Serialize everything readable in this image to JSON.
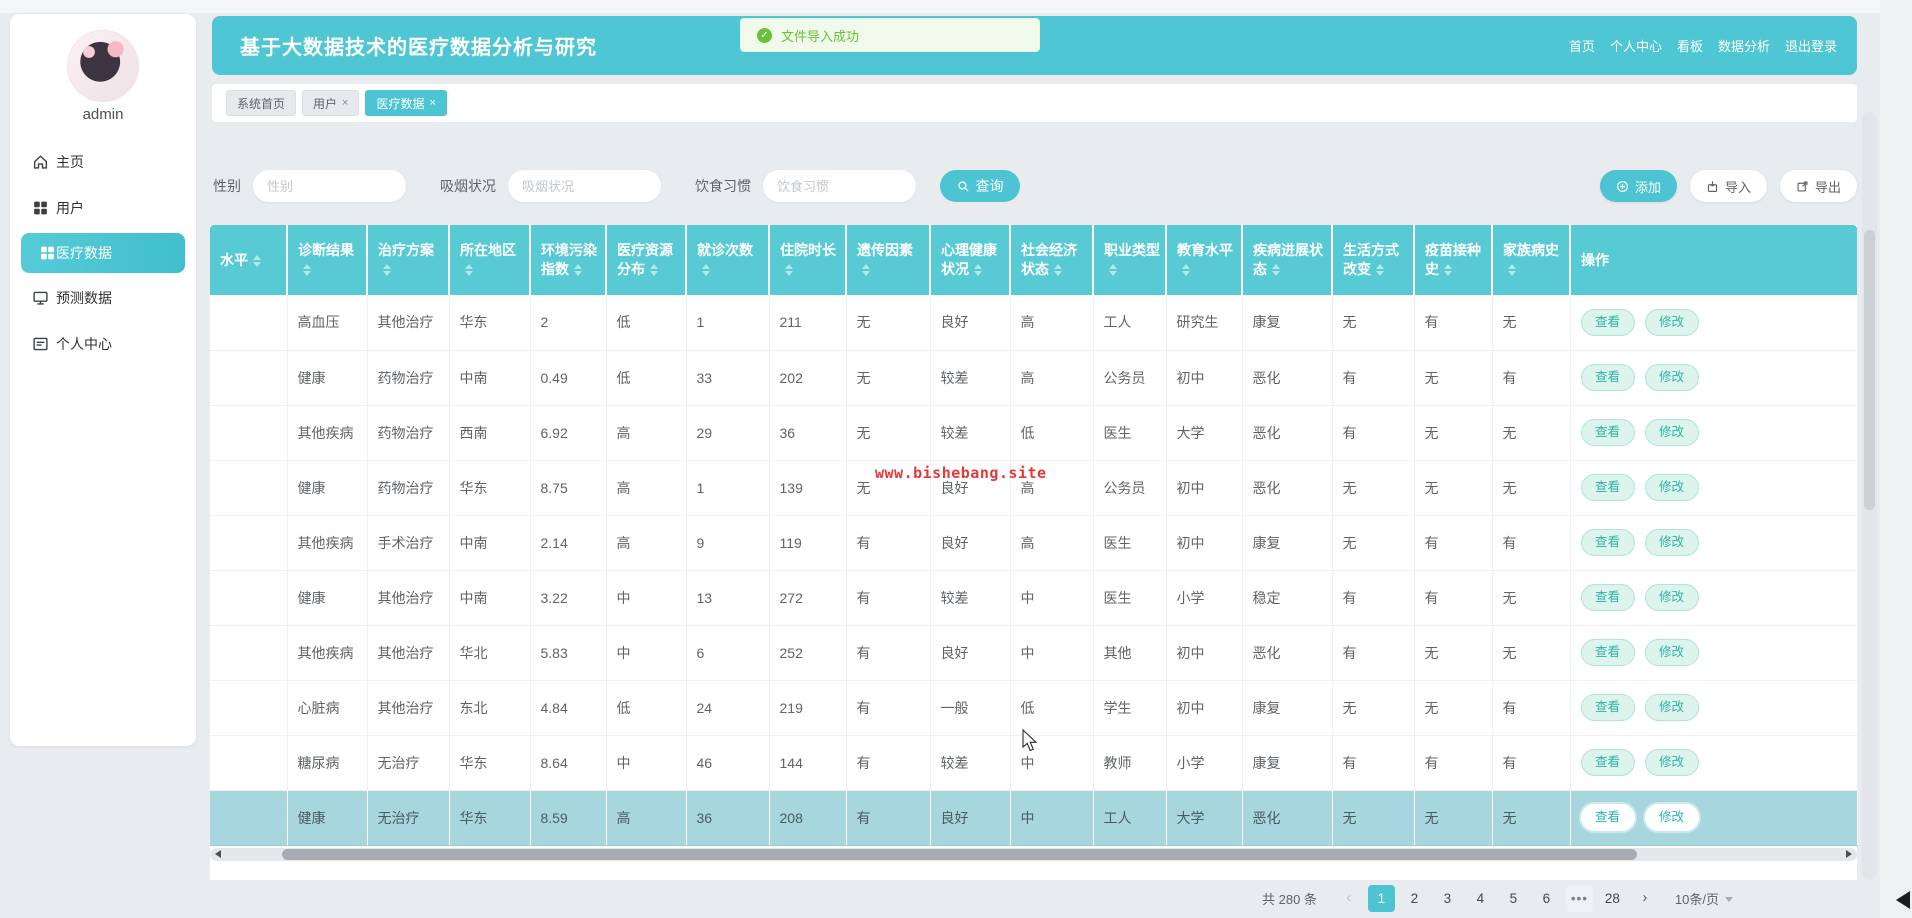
{
  "app": {
    "accent_color": "#4cc4d1",
    "header_teal": "#57cad3",
    "highlight_row_color": "#a7d6df",
    "toast_green": "#67c23a",
    "watermark_red": "#e03a3a"
  },
  "header": {
    "title": "基于大数据技术的医疗数据分析与研究",
    "nav": [
      "首页",
      "个人中心",
      "看板",
      "数据分析",
      "退出登录"
    ]
  },
  "toast": {
    "message": "文件导入成功",
    "icon": "check-circle-icon"
  },
  "sidebar": {
    "username": "admin",
    "items": [
      {
        "label": "主页",
        "icon": "home",
        "active": false
      },
      {
        "label": "用户",
        "icon": "grid",
        "active": false
      },
      {
        "label": "医疗数据",
        "icon": "grid",
        "active": true
      },
      {
        "label": "预测数据",
        "icon": "monitor",
        "active": false
      },
      {
        "label": "个人中心",
        "icon": "card",
        "active": false
      }
    ]
  },
  "tabs": [
    {
      "label": "系统首页",
      "closable": false,
      "active": false
    },
    {
      "label": "用户",
      "closable": true,
      "active": false
    },
    {
      "label": "医疗数据",
      "closable": true,
      "active": true
    }
  ],
  "filters": {
    "fields": [
      {
        "label": "性别",
        "placeholder": "性别",
        "value": ""
      },
      {
        "label": "吸烟状况",
        "placeholder": "吸烟状况",
        "value": ""
      },
      {
        "label": "饮食习惯",
        "placeholder": "饮食习惯",
        "value": ""
      }
    ],
    "search_label": "查询"
  },
  "toolbar": {
    "add_label": "添加",
    "import_label": "导入",
    "export_label": "导出"
  },
  "table": {
    "columns": [
      {
        "label": "水平",
        "sortable": true
      },
      {
        "label": "诊断结果",
        "sortable": true
      },
      {
        "label": "治疗方案",
        "sortable": true
      },
      {
        "label": "所在地区",
        "sortable": true
      },
      {
        "label": "环境污染指数",
        "sortable": true
      },
      {
        "label": "医疗资源分布",
        "sortable": true
      },
      {
        "label": "就诊次数",
        "sortable": true
      },
      {
        "label": "住院时长",
        "sortable": true
      },
      {
        "label": "遗传因素",
        "sortable": true
      },
      {
        "label": "心理健康状况",
        "sortable": true
      },
      {
        "label": "社会经济状态",
        "sortable": true
      },
      {
        "label": "职业类型",
        "sortable": true
      },
      {
        "label": "教育水平",
        "sortable": true
      },
      {
        "label": "疾病进展状态",
        "sortable": true
      },
      {
        "label": "生活方式改变",
        "sortable": true
      },
      {
        "label": "疫苗接种史",
        "sortable": true
      },
      {
        "label": "家族病史",
        "sortable": true
      },
      {
        "label": "操作",
        "sortable": false
      }
    ],
    "action_labels": [
      "查看",
      "修改"
    ],
    "highlighted_row_index": 9,
    "rows": [
      {
        "cells": [
          "高血压",
          "其他治疗",
          "华东",
          "2",
          "低",
          "1",
          "211",
          "无",
          "良好",
          "高",
          "工人",
          "研究生",
          "康复",
          "无",
          "有",
          "无"
        ]
      },
      {
        "cells": [
          "健康",
          "药物治疗",
          "中南",
          "0.49",
          "低",
          "33",
          "202",
          "无",
          "较差",
          "高",
          "公务员",
          "初中",
          "恶化",
          "有",
          "无",
          "有"
        ]
      },
      {
        "cells": [
          "其他疾病",
          "药物治疗",
          "西南",
          "6.92",
          "高",
          "29",
          "36",
          "无",
          "较差",
          "低",
          "医生",
          "大学",
          "恶化",
          "有",
          "无",
          "无"
        ]
      },
      {
        "cells": [
          "健康",
          "药物治疗",
          "华东",
          "8.75",
          "高",
          "1",
          "139",
          "无",
          "良好",
          "高",
          "公务员",
          "初中",
          "恶化",
          "无",
          "无",
          "无"
        ]
      },
      {
        "cells": [
          "其他疾病",
          "手术治疗",
          "中南",
          "2.14",
          "高",
          "9",
          "119",
          "有",
          "良好",
          "高",
          "医生",
          "初中",
          "康复",
          "无",
          "有",
          "有"
        ]
      },
      {
        "cells": [
          "健康",
          "其他治疗",
          "中南",
          "3.22",
          "中",
          "13",
          "272",
          "有",
          "较差",
          "中",
          "医生",
          "小学",
          "稳定",
          "有",
          "有",
          "无"
        ]
      },
      {
        "cells": [
          "其他疾病",
          "其他治疗",
          "华北",
          "5.83",
          "中",
          "6",
          "252",
          "有",
          "良好",
          "中",
          "其他",
          "初中",
          "恶化",
          "有",
          "无",
          "无"
        ]
      },
      {
        "cells": [
          "心脏病",
          "其他治疗",
          "东北",
          "4.84",
          "低",
          "24",
          "219",
          "有",
          "一般",
          "低",
          "学生",
          "初中",
          "康复",
          "无",
          "无",
          "有"
        ]
      },
      {
        "cells": [
          "糖尿病",
          "无治疗",
          "华东",
          "8.64",
          "中",
          "46",
          "144",
          "有",
          "较差",
          "中",
          "教师",
          "小学",
          "康复",
          "有",
          "有",
          "有"
        ]
      },
      {
        "cells": [
          "健康",
          "无治疗",
          "华东",
          "8.59",
          "高",
          "36",
          "208",
          "有",
          "良好",
          "中",
          "工人",
          "大学",
          "恶化",
          "无",
          "无",
          "无"
        ]
      }
    ]
  },
  "watermark": "www.bishebang.site",
  "pagination": {
    "total_label": "共 280 条",
    "prev": "‹",
    "pages": [
      "1",
      "2",
      "3",
      "4",
      "5",
      "6",
      "•••",
      "28"
    ],
    "active_page": "1",
    "next": "›",
    "page_size": "10条/页"
  }
}
